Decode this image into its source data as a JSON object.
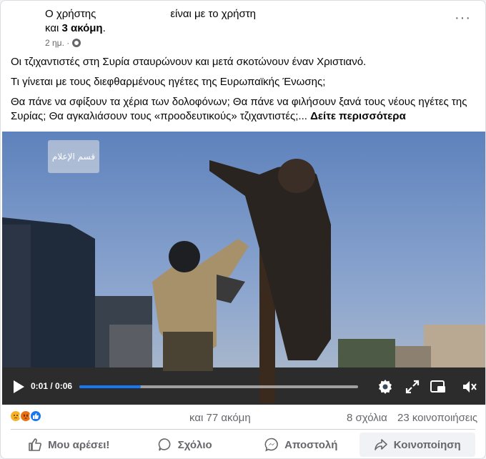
{
  "post": {
    "author_left": "Ο χρήστης",
    "author_right": "είναι με το χρήστη",
    "and_more_prefix": "και",
    "and_more_bold": "3 ακόμη",
    "and_more_suffix": ".",
    "time": "2 ημ. ·",
    "more_menu": "···",
    "paragraph1": "Οι τζιχαντιστές στη Συρία σταυρώνουν και μετά σκοτώνουν έναν Χριστιανό.",
    "paragraph2": "Τι γίνεται με τους διεφθαρμένους ηγέτες της Ευρωπαϊκής Ένωσης;",
    "paragraph3": "Θα πάνε να σφίξουν τα χέρια των δολοφόνων; Θα πάνε να φιλήσουν ξανά τους νέους ηγέτες της Συρίας; Θα αγκαλιάσουν τους «προοδευτικούς» τζιχαντιστές;...",
    "see_more": "Δείτε περισσότερα"
  },
  "video": {
    "watermark_text": "قسم الإعلام",
    "time_display": "0:01 / 0:06",
    "progress": 0.22,
    "icons": [
      "play-icon",
      "settings-icon",
      "fullscreen-icon",
      "pip-icon",
      "volume-icon"
    ]
  },
  "engagement": {
    "reactions": [
      "sad",
      "angry",
      "like"
    ],
    "reaction_text": "και 77 ακόμη",
    "comments": "8 σχόλια",
    "shares": "23 κοινοποιήσεις"
  },
  "actions": {
    "like": "Μου αρέσει!",
    "comment": "Σχόλιο",
    "send": "Αποστολή",
    "share": "Κοινοποίηση"
  },
  "colors": {
    "accent": "#1877f2",
    "secondary_text": "#65676b"
  }
}
